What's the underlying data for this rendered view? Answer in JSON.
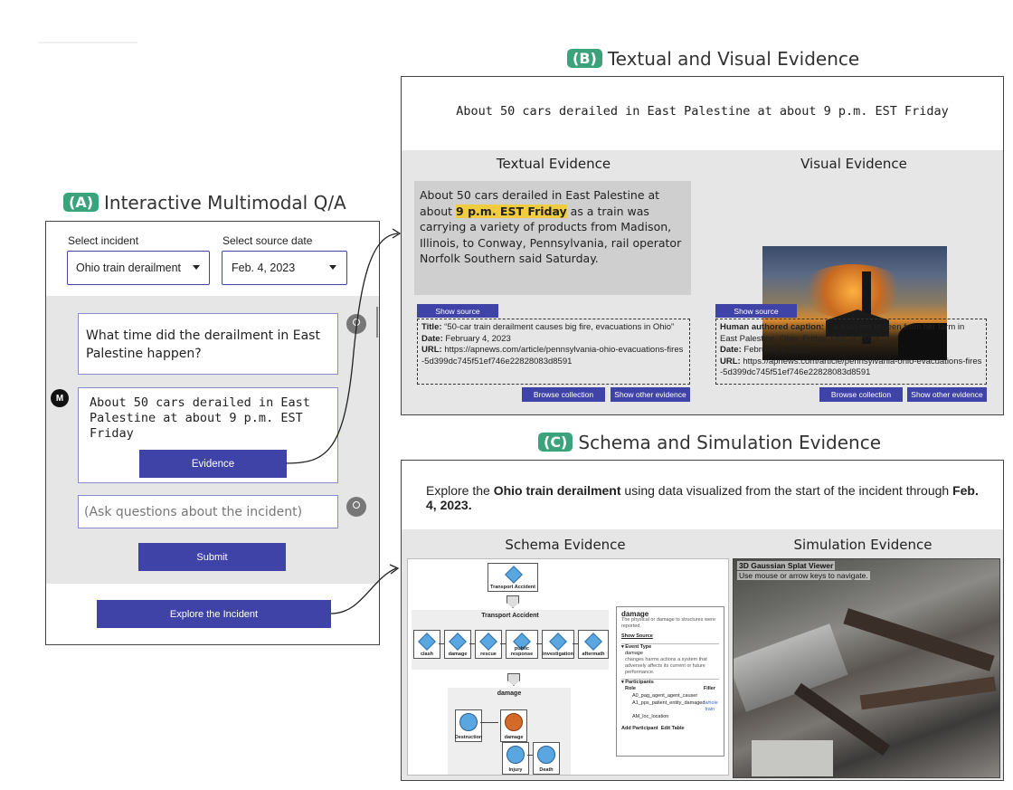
{
  "panel_a": {
    "badge": "(A)",
    "title": "Interactive Multimodal Q/A",
    "incident_label": "Select incident",
    "incident_value": "Ohio train derailment",
    "date_label": "Select source date",
    "date_value": "Feb. 4, 2023",
    "user_question": "What time did the derailment in East Palestine happen?",
    "bot_avatar": "M",
    "bot_answer": "About 50 cars derailed in East Palestine at about 9 p.m. EST Friday",
    "evidence_button": "Evidence",
    "ask_placeholder": "(Ask questions about the incident)",
    "submit_button": "Submit",
    "explore_button": "Explore the Incident"
  },
  "panel_b": {
    "badge": "(B)",
    "title": "Textual and Visual Evidence",
    "claim": "About 50 cars derailed in East Palestine at about 9 p.m. EST Friday",
    "textual_heading": "Textual Evidence",
    "visual_heading": "Visual Evidence",
    "text_pre": "About 50 cars derailed in East Palestine at about ",
    "text_highlight": "9 p.m. EST Friday",
    "text_post": " as a train was carrying a variety of products from Madison, Illinois, to Conway, Pennsylvania, rail operator Norfolk Southern said Saturday.",
    "show_source": "Show source",
    "text_meta": {
      "title_label": "Title:",
      "title_value": "“50-car train derailment causes big fire, evacuations in Ohio”",
      "date_label": "Date:",
      "date_value": "February 4, 2023",
      "url_label": "URL:",
      "url_value": "https://apnews.com/article/pennsylvania-ohio-evacuations-fires-5d399dc745f51ef746e22828083d8591"
    },
    "visual_meta": {
      "caption_label": "Human authored caption:",
      "caption_value": "...a train fire is seen from her farm in East Palestine, Ohio, Friday, Feb. 3, 2023...",
      "date_label": "Date:",
      "date_value": "February 4, 2023",
      "url_label": "URL:",
      "url_value": "https://apnews.com/article/pennsylvania-ohio-evacuations-fires-5d399dc745f51ef746e22828083d8591"
    },
    "browse_collection": "Browse collection",
    "show_other": "Show other evidence"
  },
  "panel_c": {
    "badge": "(C)",
    "title": "Schema and Simulation Evidence",
    "intro_pre": "Explore the ",
    "intro_bold": "Ohio train derailment",
    "intro_mid": " using data visualized from the start of the incident through ",
    "intro_bold2": "Feb. 4, 2023.",
    "schema_heading": "Schema Evidence",
    "simulation_heading": "Simulation Evidence",
    "schema": {
      "top_node": "Transport Accident",
      "group_title": "Transport Accident",
      "steps": [
        "clash",
        "damage",
        "rescue",
        "public response",
        "investigation",
        "aftermath"
      ],
      "sub_title": "damage",
      "sub_nodes": [
        "Destruction",
        "damage",
        "Injury",
        "Death"
      ],
      "detail": {
        "title": "damage",
        "desc": "The physical or damage to structures were reported.",
        "show_source": "Show Source",
        "event_type_label": "▾ Event Type",
        "event_type_name": "damage",
        "event_type_desc": "changes harms actions a system that adversely affects its current or future performance.",
        "participants_label": "▾ Participants",
        "role_header": "Role",
        "filler_header": "Filler",
        "rows": [
          {
            "role": "A0_pag_agent_agent_causer",
            "filler": ""
          },
          {
            "role": "A1_pps_patient_entity_damaged",
            "filler": "whole train"
          },
          {
            "role": "AM_loc_location",
            "filler": ""
          }
        ],
        "add_participant": "Add Participant",
        "edit_table": "Edit Table"
      }
    },
    "sim_title": "3D Gaussian Splat Viewer",
    "sim_hint": "Use mouse or arrow keys to navigate."
  },
  "colors": {
    "accent": "#3f43a8",
    "badge": "#3aa37c",
    "highlight": "#f2cc3f"
  }
}
